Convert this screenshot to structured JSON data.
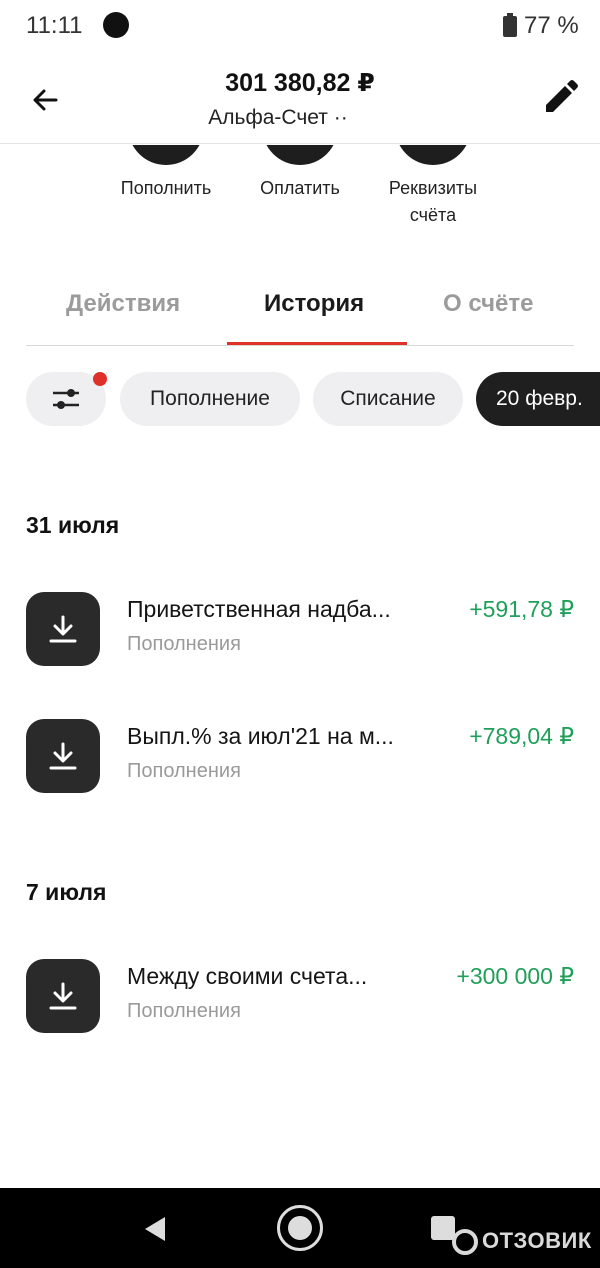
{
  "status_bar": {
    "time": "11:11",
    "battery": "77 %"
  },
  "header": {
    "balance": "301 380,82 ₽",
    "account_name": "Альфа-Счет ··"
  },
  "actions": [
    {
      "label": "Пополнить"
    },
    {
      "label": "Оплатить"
    },
    {
      "label": "Реквизиты\nсчёта"
    }
  ],
  "tabs": [
    {
      "label": "Действия",
      "active": false
    },
    {
      "label": "История",
      "active": true
    },
    {
      "label": "О счёте",
      "active": false
    }
  ],
  "filters": {
    "has_active_filter": true,
    "chips": [
      {
        "label": "Пополнение"
      },
      {
        "label": "Списание"
      },
      {
        "label": "20 февр."
      }
    ]
  },
  "history": [
    {
      "date": "31 июля",
      "transactions": [
        {
          "title": "Приветственная надба...",
          "category": "Пополнения",
          "amount": "+591,78 ₽",
          "icon": "download-icon"
        },
        {
          "title": "Выпл.% за июл'21 на м...",
          "category": "Пополнения",
          "amount": "+789,04 ₽",
          "icon": "download-icon"
        }
      ]
    },
    {
      "date": "7 июля",
      "transactions": [
        {
          "title": "Между своими счета...",
          "category": "Пополнения",
          "amount": "+300 000 ₽",
          "icon": "download-icon"
        }
      ]
    }
  ],
  "colors": {
    "accent": "#e0302a",
    "income": "#1f9f5a",
    "dark": "#1f1f1f"
  },
  "watermark": "ОТЗОВИК"
}
